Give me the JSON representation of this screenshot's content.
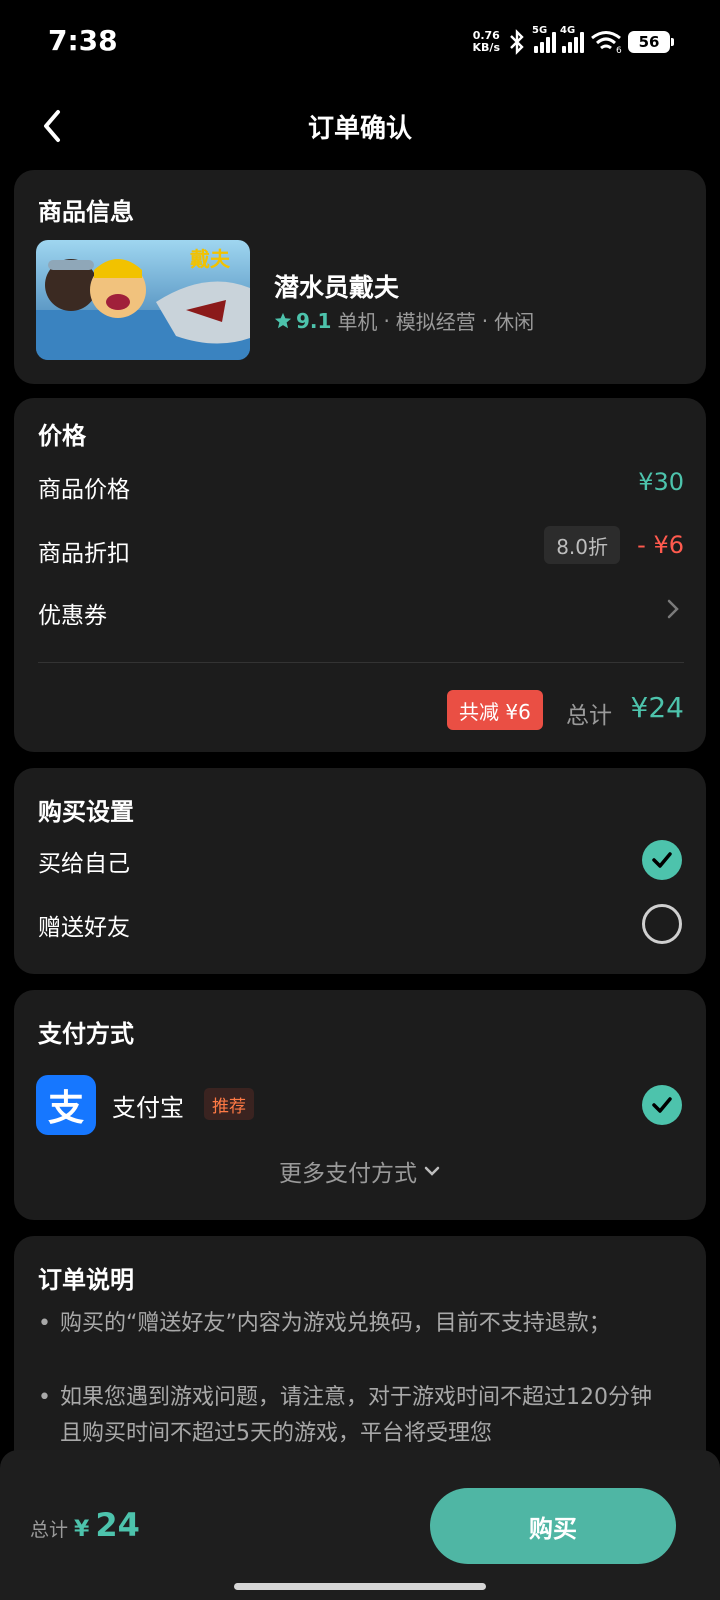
{
  "status": {
    "time": "7:38",
    "speed_value": "0.76",
    "speed_unit": "KB/s",
    "net1": "5G",
    "net2": "4G",
    "wifi_num": "6",
    "battery": "56"
  },
  "header": {
    "title": "订单确认"
  },
  "product": {
    "section_title": "商品信息",
    "name": "潜水员戴夫",
    "rating": "9.1",
    "tags": [
      "单机",
      "模拟经营",
      "休闲"
    ],
    "separator": "·"
  },
  "price": {
    "section_title": "价格",
    "item_price_label": "商品价格",
    "item_price": "¥30",
    "discount_label": "商品折扣",
    "discount_badge": "8.0折",
    "discount_amount": "- ¥6",
    "coupon_label": "优惠券",
    "total_reduce_badge": "共减 ¥6",
    "total_label": "总计",
    "total": "¥24"
  },
  "purchase": {
    "section_title": "购买设置",
    "options": [
      {
        "label": "买给自己",
        "selected": true
      },
      {
        "label": "赠送好友",
        "selected": false
      }
    ]
  },
  "payment": {
    "section_title": "支付方式",
    "method": "支付宝",
    "alipay_glyph": "支",
    "recommend_badge": "推荐",
    "more_label": "更多支付方式"
  },
  "notes": {
    "section_title": "订单说明",
    "items": [
      "购买的“赠送好友”内容为游戏兑换码，目前不支持退款；",
      "如果您遇到游戏问题，请注意，对于游戏时间不超过120分钟且购买时间不超过5天的游戏，平台将受理您"
    ]
  },
  "bottom": {
    "total_label": "总计",
    "currency": "¥",
    "total": "24",
    "buy_label": "购买"
  },
  "colors": {
    "accent": "#4dc3ac",
    "red": "#ff5a4e",
    "card": "#1c1c1c",
    "alipay": "#1677ff"
  }
}
